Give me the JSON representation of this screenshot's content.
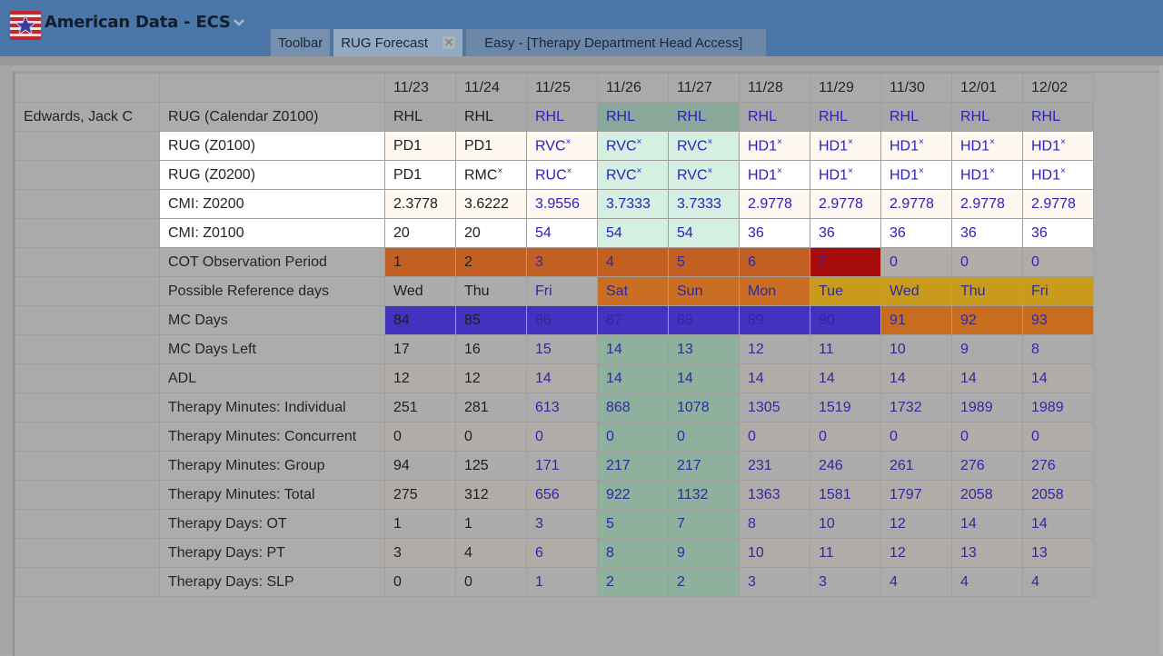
{
  "app": {
    "title": "American Data - ECS",
    "logo_icon": "flag-star-icon",
    "menu_icon": "chevron-down-icon"
  },
  "tabs": [
    {
      "label": "Toolbar",
      "active": false
    },
    {
      "label": "RUG Forecast",
      "active": true,
      "close_icon": "close-icon"
    },
    {
      "label": "Easy - [Therapy Department Head Access]",
      "active": false
    }
  ],
  "colors": {
    "titlebar": "#4a77a8",
    "value_blue": "#2a22b8",
    "cot_orange": "#c26024",
    "cot_red": "#a80d0d",
    "ref_yellow": "#c99b1c",
    "mc_blue": "#4332bf",
    "highlight_green": "#d6efe3"
  },
  "grid": {
    "patient": "Edwards, Jack C",
    "dates": [
      "11/23",
      "11/24",
      "11/25",
      "11/26",
      "11/27",
      "11/28",
      "11/29",
      "11/30",
      "12/01",
      "12/02"
    ],
    "rows": [
      {
        "label": "RUG (Calendar Z0100)",
        "values": [
          "RHL",
          "RHL",
          "RHL",
          "RHL",
          "RHL",
          "RHL",
          "RHL",
          "RHL",
          "RHL",
          "RHL"
        ]
      },
      {
        "label": "RUG (Z0100)",
        "values": [
          "PD1",
          "PD1",
          "RVC*",
          "RVC*",
          "RVC*",
          "HD1*",
          "HD1*",
          "HD1*",
          "HD1*",
          "HD1*"
        ]
      },
      {
        "label": "RUG (Z0200)",
        "values": [
          "PD1",
          "RMC*",
          "RUC*",
          "RVC*",
          "RVC*",
          "HD1*",
          "HD1*",
          "HD1*",
          "HD1*",
          "HD1*"
        ]
      },
      {
        "label": "CMI: Z0200",
        "values": [
          "2.3778",
          "3.6222",
          "3.9556",
          "3.7333",
          "3.7333",
          "2.9778",
          "2.9778",
          "2.9778",
          "2.9778",
          "2.9778"
        ]
      },
      {
        "label": "CMI: Z0100",
        "values": [
          "20",
          "20",
          "54",
          "54",
          "54",
          "36",
          "36",
          "36",
          "36",
          "36"
        ]
      },
      {
        "label": "COT Observation Period",
        "values": [
          "1",
          "2",
          "3",
          "4",
          "5",
          "6",
          "7",
          "0",
          "0",
          "0"
        ]
      },
      {
        "label": "Possible Reference days",
        "values": [
          "Wed",
          "Thu",
          "Fri",
          "Sat",
          "Sun",
          "Mon",
          "Tue",
          "Wed",
          "Thu",
          "Fri"
        ]
      },
      {
        "label": "MC Days",
        "values": [
          "84",
          "85",
          "86",
          "87",
          "88",
          "89",
          "90",
          "91",
          "92",
          "93"
        ]
      },
      {
        "label": "MC Days Left",
        "values": [
          "17",
          "16",
          "15",
          "14",
          "13",
          "12",
          "11",
          "10",
          "9",
          "8"
        ]
      },
      {
        "label": "ADL",
        "values": [
          "12",
          "12",
          "14",
          "14",
          "14",
          "14",
          "14",
          "14",
          "14",
          "14"
        ]
      },
      {
        "label": "Therapy Minutes: Individual",
        "values": [
          "251",
          "281",
          "613",
          "868",
          "1078",
          "1305",
          "1519",
          "1732",
          "1989",
          "1989"
        ]
      },
      {
        "label": "Therapy Minutes: Concurrent",
        "values": [
          "0",
          "0",
          "0",
          "0",
          "0",
          "0",
          "0",
          "0",
          "0",
          "0"
        ]
      },
      {
        "label": "Therapy Minutes: Group",
        "values": [
          "94",
          "125",
          "171",
          "217",
          "217",
          "231",
          "246",
          "261",
          "276",
          "276"
        ]
      },
      {
        "label": "Therapy Minutes: Total",
        "values": [
          "275",
          "312",
          "656",
          "922",
          "1132",
          "1363",
          "1581",
          "1797",
          "2058",
          "2058"
        ]
      },
      {
        "label": "Therapy Days: OT",
        "values": [
          "1",
          "1",
          "3",
          "5",
          "7",
          "8",
          "10",
          "12",
          "14",
          "14"
        ]
      },
      {
        "label": "Therapy Days: PT",
        "values": [
          "3",
          "4",
          "6",
          "8",
          "9",
          "10",
          "11",
          "12",
          "13",
          "13"
        ]
      },
      {
        "label": "Therapy Days: SLP",
        "values": [
          "0",
          "0",
          "1",
          "2",
          "2",
          "3",
          "3",
          "4",
          "4",
          "4"
        ]
      }
    ]
  }
}
